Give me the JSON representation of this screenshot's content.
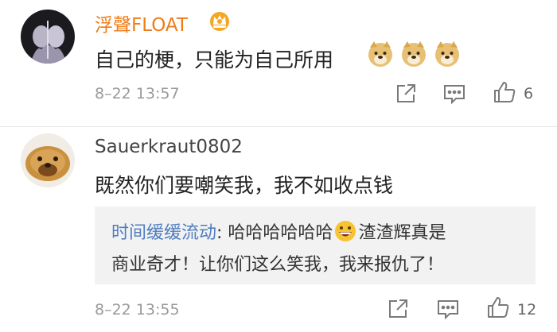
{
  "comments": [
    {
      "username": "浮聲FLOAT",
      "text": "自己的梗，只能为自己所用",
      "emoji_icons": [
        "doge-icon",
        "doge-icon",
        "doge-icon"
      ],
      "badge_icon": "vip-crown-icon",
      "timestamp": "8–22 13:57",
      "like_count": "6"
    },
    {
      "username": "Sauerkraut0802",
      "text": "既然你们要嘲笑我，我不如收点钱",
      "reply": {
        "username": "时间缓缓流动",
        "separator": ": ",
        "text_before_emoji": "哈哈哈哈哈哈",
        "emoji_icon": "grinning-face-icon",
        "text_after_emoji": "渣渣辉真是",
        "line2": "商业奇才！让你们这么笑我，我来报仇了！"
      },
      "timestamp": "8–22 13:55",
      "like_count": "12"
    }
  ],
  "colors": {
    "vip_username": "#f07b16",
    "username": "#444444",
    "reply_username": "#4f7dc0",
    "meta": "#9a9a9a",
    "quote_bg": "#f2f2f2"
  }
}
